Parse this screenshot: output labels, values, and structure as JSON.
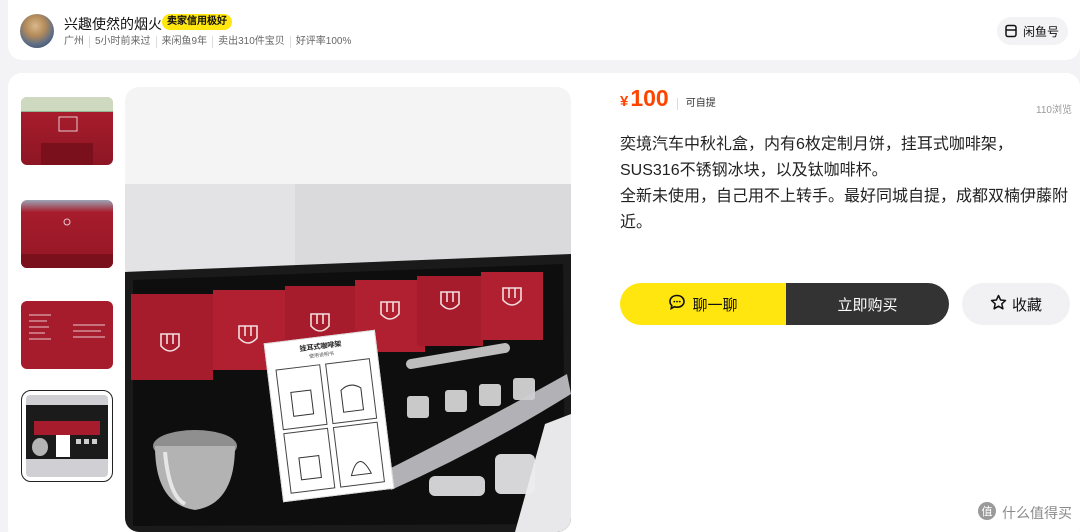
{
  "seller": {
    "name": "兴趣使然的烟火",
    "badge": "卖家信用极好",
    "location": "广州",
    "last_seen": "5小时前来过",
    "years": "来闲鱼9年",
    "sold": "卖出310件宝贝",
    "rating": "好评率100%"
  },
  "header_button": {
    "label": "闲鱼号",
    "icon": "card-icon"
  },
  "item": {
    "price_symbol": "¥",
    "price": "100",
    "pickup": "可自提",
    "views": "110浏览",
    "description_line1": "奕境汽车中秋礼盒，内有6枚定制月饼，挂耳式咖啡架，SUS316不锈钢冰块，以及钛咖啡杯。",
    "description_line2": "全新未使用，自己用不上转手。最好同城自提，成都双楠伊藤附近。"
  },
  "instructions_card": {
    "title": "挂耳式咖啡架",
    "subtitle": "使用说明书"
  },
  "actions": {
    "chat_label": "聊一聊",
    "buy_label": "立即购买",
    "favorite_label": "收藏"
  },
  "watermark": {
    "text": "什么值得买"
  },
  "colors": {
    "accent_yellow": "#ffe60f",
    "price_orange": "#ff4400",
    "dark_button": "#333333",
    "gift_box_red": "#a71c2c"
  }
}
